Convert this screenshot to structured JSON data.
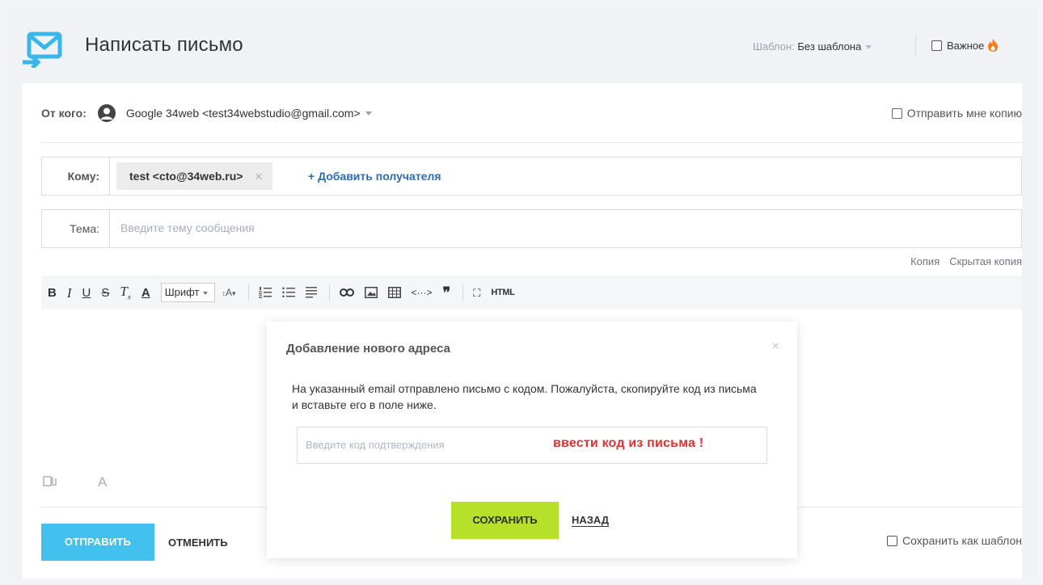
{
  "header": {
    "title": "Написать письмо",
    "template_label": "Шаблон:",
    "template_value": "Без шаблона",
    "important_label": "Важное"
  },
  "from": {
    "label": "От кого:",
    "address": "Google 34web <test34webstudio@gmail.com>",
    "send_copy_label": "Отправить мне копию"
  },
  "to": {
    "label": "Кому:",
    "recipients": [
      {
        "text": "test <cto@34web.ru>"
      }
    ],
    "add_recipient": "+ Добавить получателя"
  },
  "subject": {
    "label": "Тема:",
    "placeholder": "Введите тему сообщения",
    "value": ""
  },
  "cc_links": {
    "cc": "Копия",
    "bcc": "Скрытая копия"
  },
  "toolbar": {
    "bold": "B",
    "italic": "I",
    "underline": "U",
    "strike": "S",
    "clear_format": "T",
    "text_color": "A",
    "font_label": "Шрифт",
    "font_size": "A",
    "html_label": "HTML"
  },
  "editor_bottom": {
    "size_icon_label": "A"
  },
  "actions": {
    "send": "ОТПРАВИТЬ",
    "cancel": "ОТМЕНИТЬ",
    "save_template": "Сохранить как шаблон"
  },
  "modal": {
    "title": "Добавление нового адреса",
    "close": "×",
    "message": "На указанный email отправлено письмо с кодом. Пожалуйста, скопируйте код из письма и вставьте его в поле ниже.",
    "code_placeholder": "Введите код подтверждения",
    "code_annotation": "ввести код из письма !",
    "save": "СОХРАНИТЬ",
    "back": "НАЗАД"
  },
  "colors": {
    "send_button": "#42c1ef",
    "save_button": "#b7e02a",
    "link": "#2d6bb5",
    "annotation": "#e03131",
    "logo": "#3ab7ea"
  }
}
